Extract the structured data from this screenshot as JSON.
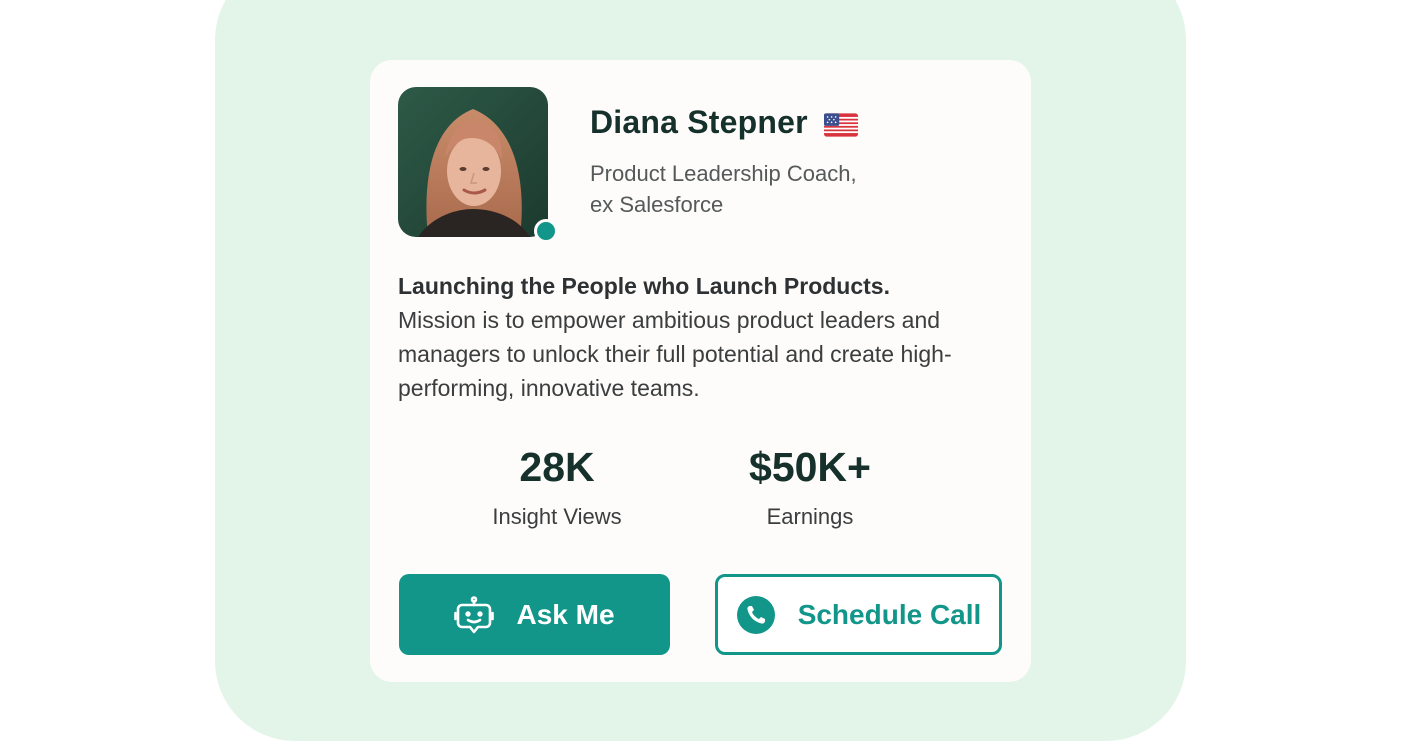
{
  "profile": {
    "name": "Diana Stepner",
    "flag_icon": "us-flag-icon",
    "role_line1": "Product Leadership Coach,",
    "role_line2": "ex Salesforce",
    "online_status_color": "#12968a"
  },
  "bio": {
    "headline": "Launching the People who Launch Products.",
    "body": "Mission is to empower ambitious product leaders and managers to unlock their full potential and create high-performing, innovative teams."
  },
  "stats": [
    {
      "value": "28K",
      "label": "Insight Views"
    },
    {
      "value": "$50K+",
      "label": "Earnings"
    }
  ],
  "actions": {
    "ask_label": "Ask Me",
    "ask_icon": "robot-chat-icon",
    "call_label": "Schedule Call",
    "call_icon": "phone-icon"
  },
  "colors": {
    "accent": "#12968a",
    "backdrop": "#e2f5e8",
    "card": "#fdfcfa",
    "heading": "#16302b"
  }
}
